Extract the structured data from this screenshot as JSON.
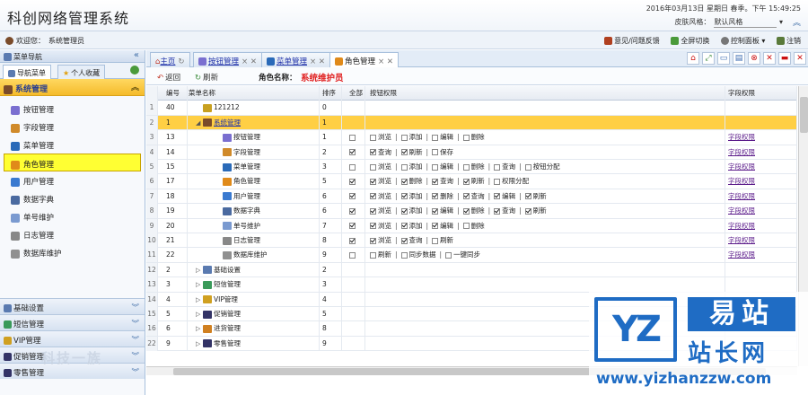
{
  "header": {
    "title": "科创网络管理系统",
    "datetime": "2016年03月13日 星期日 春季。下午 15:49:25",
    "skin_label": "皮肤风格：",
    "skin_value": "默认风格"
  },
  "userbar": {
    "welcome": "欢迎您：",
    "username": "系统管理员",
    "tools": [
      {
        "label": "意见/问题反馈",
        "icon": "bug-icon"
      },
      {
        "label": "全屏切换",
        "icon": "fullscreen-icon"
      },
      {
        "label": "控制面板",
        "icon": "gear-icon"
      },
      {
        "label": "注销",
        "icon": "logout-icon"
      }
    ]
  },
  "sidebar": {
    "title": "菜单导航",
    "tabs": [
      "导航菜单",
      "个人收藏"
    ],
    "group_active": "系统管理",
    "items": [
      {
        "label": "按钮管理",
        "icon": "tag-icon",
        "color": "#7a6fd0"
      },
      {
        "label": "字段管理",
        "icon": "table-icon",
        "color": "#d08a2a"
      },
      {
        "label": "菜单管理",
        "icon": "window-icon",
        "color": "#2a6ab8"
      },
      {
        "label": "角色管理",
        "icon": "role-icon",
        "color": "#e08a1a"
      },
      {
        "label": "用户管理",
        "icon": "user-icon",
        "color": "#3a7ad0"
      },
      {
        "label": "数据字典",
        "icon": "book-icon",
        "color": "#4a6aa0"
      },
      {
        "label": "单号维护",
        "icon": "number-icon",
        "color": "#7a9ad0"
      },
      {
        "label": "日志管理",
        "icon": "log-icon",
        "color": "#888888"
      },
      {
        "label": "数据库维护",
        "icon": "database-icon",
        "color": "#909090"
      }
    ],
    "groups": [
      "基础设置",
      "短信管理",
      "VIP管理",
      "促销管理",
      "零售管理"
    ]
  },
  "tabs": [
    {
      "label": "主页",
      "icon": "home-icon"
    },
    {
      "label": "按钮管理",
      "icon": "tag-icon"
    },
    {
      "label": "菜单管理",
      "icon": "window-icon"
    },
    {
      "label": "角色管理",
      "icon": "role-icon"
    }
  ],
  "toolbar": {
    "back": "返回",
    "refresh": "刷新",
    "role_label": "角色名称：",
    "role_name": "系统维护员"
  },
  "grid": {
    "headers": [
      "编号",
      "菜单名称",
      "排序",
      "全部",
      "按钮权限",
      "字段权限"
    ],
    "rows": [
      {
        "n": "1",
        "id": "40",
        "name": "121212",
        "sort": "0",
        "all": null,
        "perms": [],
        "field": "",
        "indent": 0,
        "tri": "",
        "icon": "#c8a020"
      },
      {
        "n": "2",
        "id": "1",
        "name": "系统管理",
        "sort": "1",
        "all": null,
        "perms": [],
        "field": "",
        "indent": 0,
        "tri": "◢",
        "icon": "#7a4b2a",
        "sel": true
      },
      {
        "n": "3",
        "id": "13",
        "name": "按钮管理",
        "sort": "1",
        "all": false,
        "perms": [
          [
            "浏览",
            false
          ],
          [
            "添加",
            false
          ],
          [
            "编辑",
            false
          ],
          [
            "删除",
            false
          ]
        ],
        "field": "字段权限",
        "indent": 1,
        "icon": "#7a6fd0"
      },
      {
        "n": "4",
        "id": "14",
        "name": "字段管理",
        "sort": "2",
        "all": true,
        "perms": [
          [
            "查询",
            true
          ],
          [
            "刷新",
            true
          ],
          [
            "保存",
            false
          ]
        ],
        "field": "字段权限",
        "indent": 1,
        "icon": "#d08a2a"
      },
      {
        "n": "5",
        "id": "15",
        "name": "菜单管理",
        "sort": "3",
        "all": false,
        "perms": [
          [
            "浏览",
            false
          ],
          [
            "添加",
            false
          ],
          [
            "编辑",
            false
          ],
          [
            "删除",
            false
          ],
          [
            "查询",
            false
          ],
          [
            "按钮分配",
            false
          ]
        ],
        "field": "字段权限",
        "indent": 1,
        "icon": "#2a6ab8"
      },
      {
        "n": "6",
        "id": "17",
        "name": "角色管理",
        "sort": "5",
        "all": true,
        "perms": [
          [
            "浏览",
            true
          ],
          [
            "删除",
            true
          ],
          [
            "查询",
            true
          ],
          [
            "刷新",
            true
          ],
          [
            "权限分配",
            false
          ]
        ],
        "field": "字段权限",
        "indent": 1,
        "icon": "#e08a1a"
      },
      {
        "n": "7",
        "id": "18",
        "name": "用户管理",
        "sort": "6",
        "all": true,
        "perms": [
          [
            "浏览",
            true
          ],
          [
            "添加",
            true
          ],
          [
            "删除",
            true
          ],
          [
            "查询",
            true
          ],
          [
            "编辑",
            true
          ],
          [
            "刷新",
            true
          ]
        ],
        "field": "字段权限",
        "indent": 1,
        "icon": "#3a7ad0"
      },
      {
        "n": "8",
        "id": "19",
        "name": "数据字典",
        "sort": "6",
        "all": true,
        "perms": [
          [
            "浏览",
            true
          ],
          [
            "添加",
            true
          ],
          [
            "编辑",
            true
          ],
          [
            "删除",
            true
          ],
          [
            "查询",
            true
          ],
          [
            "刷新",
            true
          ]
        ],
        "field": "字段权限",
        "indent": 1,
        "icon": "#4a6aa0"
      },
      {
        "n": "9",
        "id": "20",
        "name": "单号维护",
        "sort": "7",
        "all": true,
        "perms": [
          [
            "浏览",
            true
          ],
          [
            "添加",
            true
          ],
          [
            "编辑",
            true
          ],
          [
            "删除",
            false
          ]
        ],
        "field": "字段权限",
        "indent": 1,
        "icon": "#7a9ad0"
      },
      {
        "n": "10",
        "id": "21",
        "name": "日志管理",
        "sort": "8",
        "all": true,
        "perms": [
          [
            "浏览",
            true
          ],
          [
            "查询",
            true
          ],
          [
            "刷新",
            false
          ]
        ],
        "field": "字段权限",
        "indent": 1,
        "icon": "#888888"
      },
      {
        "n": "11",
        "id": "22",
        "name": "数据库维护",
        "sort": "9",
        "all": false,
        "perms": [
          [
            "刷新",
            false
          ],
          [
            "同步数据",
            false
          ],
          [
            "一键同步",
            false
          ]
        ],
        "field": "字段权限",
        "indent": 1,
        "icon": "#909090"
      },
      {
        "n": "12",
        "id": "2",
        "name": "基础设置",
        "sort": "2",
        "all": null,
        "perms": [],
        "field": "",
        "indent": 0,
        "tri": "▷",
        "icon": "#5a7ab0"
      },
      {
        "n": "13",
        "id": "3",
        "name": "短信管理",
        "sort": "3",
        "all": null,
        "perms": [],
        "field": "",
        "indent": 0,
        "tri": "▷",
        "icon": "#3a9a5a"
      },
      {
        "n": "14",
        "id": "4",
        "name": "VIP管理",
        "sort": "4",
        "all": null,
        "perms": [],
        "field": "",
        "indent": 0,
        "tri": "▷",
        "icon": "#d0a020"
      },
      {
        "n": "15",
        "id": "5",
        "name": "促销管理",
        "sort": "5",
        "all": null,
        "perms": [],
        "field": "",
        "indent": 0,
        "tri": "▷",
        "icon": "#333366"
      },
      {
        "n": "16",
        "id": "6",
        "name": "进货管理",
        "sort": "8",
        "all": null,
        "perms": [],
        "field": "",
        "indent": 0,
        "tri": "▷",
        "icon": "#d08020"
      },
      {
        "n": "22",
        "id": "9",
        "name": "零售管理",
        "sort": "9",
        "all": null,
        "perms": [],
        "field": "",
        "indent": 0,
        "tri": "▷",
        "icon": "#333366"
      }
    ]
  },
  "watermark": {
    "logo": "YZ",
    "cn1": "易站",
    "cn2": "站长网",
    "url": "www.yizhanzzw.com",
    "left": "科技一族"
  }
}
